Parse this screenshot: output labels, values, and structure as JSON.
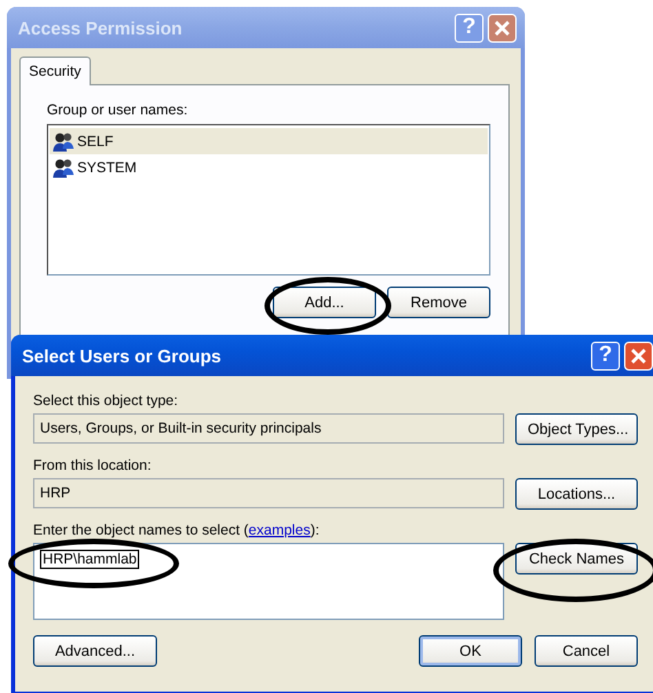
{
  "access_permission_window": {
    "title": "Access Permission",
    "active": false,
    "help_button": "?",
    "tabs": [
      {
        "label": "Security",
        "selected": true
      }
    ],
    "list_label": "Group or user names:",
    "list_items": [
      {
        "name": "SELF",
        "selected": true
      },
      {
        "name": "SYSTEM",
        "selected": false
      }
    ],
    "buttons": [
      "Add...",
      "Remove"
    ]
  },
  "select_users_window": {
    "title": "Select Users or Groups",
    "active": true,
    "help_button": "?",
    "object_type": {
      "label": "Select this object type:",
      "value": "Users, Groups, or Built-in security principals",
      "button": "Object Types..."
    },
    "location": {
      "label": "From this location:",
      "value": "HRP",
      "button": "Locations..."
    },
    "names": {
      "label_prefix": "Enter the object names to select (",
      "link": "examples",
      "label_suffix": "):",
      "value": "HRP\\hammlab",
      "button": "Check Names"
    },
    "buttons": [
      {
        "label": "Advanced...",
        "default": false
      },
      {
        "label": "OK",
        "default": true
      },
      {
        "label": "Cancel",
        "default": false
      }
    ]
  }
}
